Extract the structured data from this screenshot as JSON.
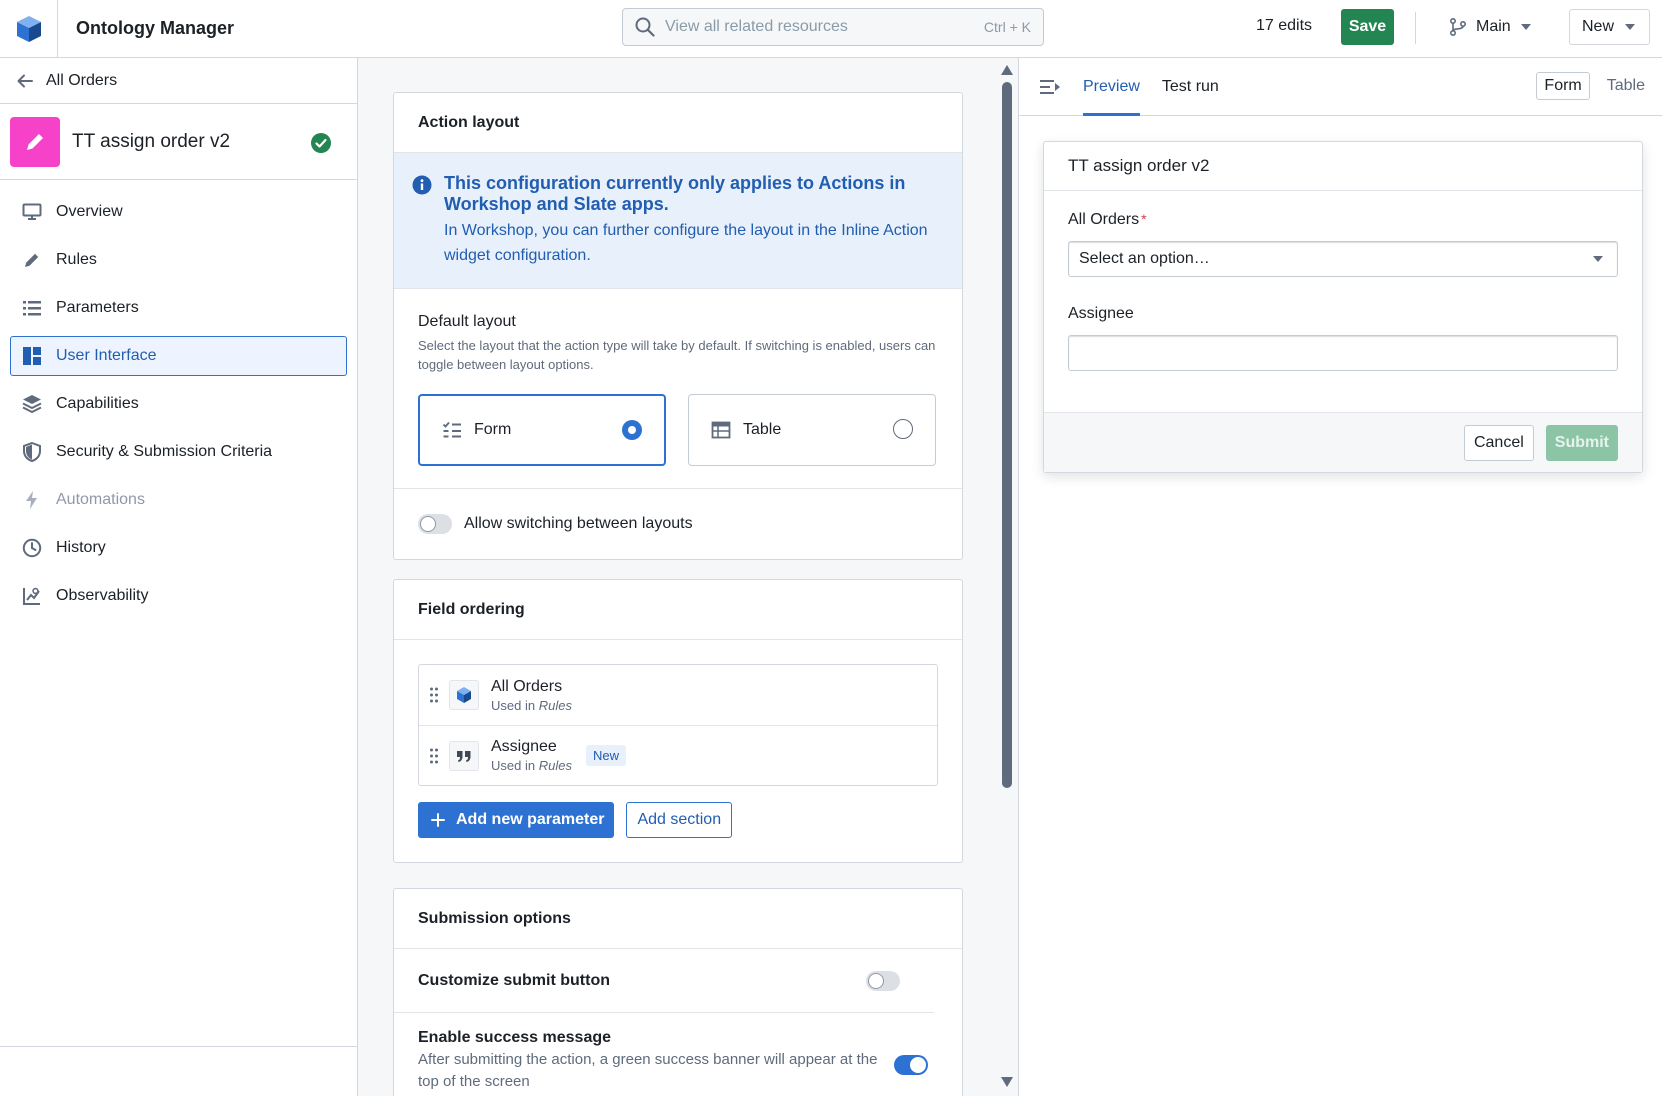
{
  "header": {
    "app_title": "Ontology Manager",
    "search_placeholder": "View all related resources",
    "search_shortcut": "Ctrl + K",
    "edits": "17 edits",
    "save_label": "Save",
    "branch": "Main",
    "new_label": "New"
  },
  "sidebar": {
    "back_label": "All Orders",
    "action_name": "TT assign order v2",
    "items": [
      {
        "label": "Overview"
      },
      {
        "label": "Rules"
      },
      {
        "label": "Parameters"
      },
      {
        "label": "User Interface"
      },
      {
        "label": "Capabilities"
      },
      {
        "label": "Security & Submission Criteria"
      },
      {
        "label": "Automations"
      },
      {
        "label": "History"
      },
      {
        "label": "Observability"
      }
    ]
  },
  "action_layout": {
    "title": "Action layout",
    "callout_title": "This configuration currently only applies to Actions in Workshop and Slate apps.",
    "callout_body": "In Workshop, you can further configure the layout in the Inline Action widget configuration.",
    "default_title": "Default layout",
    "default_desc": "Select the layout that the action type will take by default. If switching is enabled, users can toggle between layout options.",
    "option_form": "Form",
    "option_table": "Table",
    "switch_label": "Allow switching between layouts"
  },
  "field_ordering": {
    "title": "Field ordering",
    "fields": [
      {
        "name": "All Orders",
        "used_prefix": "Used in",
        "used_in": "Rules",
        "tag": ""
      },
      {
        "name": "Assignee",
        "used_prefix": "Used in",
        "used_in": "Rules",
        "tag": "New"
      }
    ],
    "add_param": "Add new parameter",
    "add_section": "Add section"
  },
  "submission": {
    "title": "Submission options",
    "customize_label": "Customize submit button",
    "success_label": "Enable success message",
    "success_desc": "After submitting the action, a green success banner will appear at the top of the screen"
  },
  "preview": {
    "tab_preview": "Preview",
    "tab_test": "Test run",
    "seg_form": "Form",
    "seg_table": "Table",
    "card_title": "TT assign order v2",
    "field1_label": "All Orders",
    "required_mark": "*",
    "field1_placeholder": "Select an option…",
    "field2_label": "Assignee",
    "cancel": "Cancel",
    "submit": "Submit"
  },
  "colors": {
    "save_green": "#238551",
    "accent_blue": "#2d72d2",
    "action_pink": "#f542c8"
  }
}
